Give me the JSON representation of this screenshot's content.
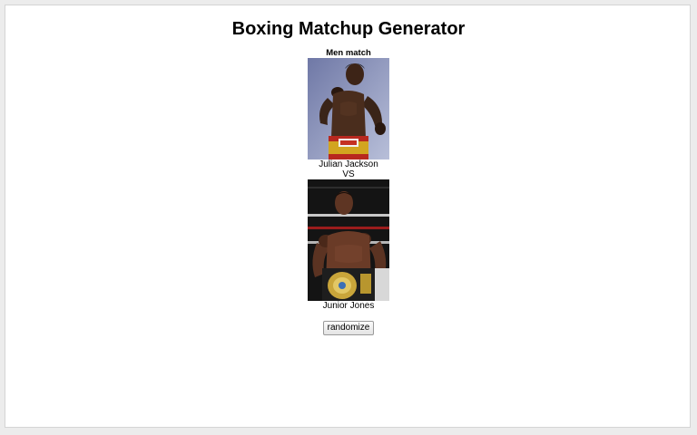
{
  "page": {
    "title": "Boxing Matchup Generator"
  },
  "match": {
    "section_label": "Men match",
    "fighter1": {
      "name": "Julian Jackson"
    },
    "vs_label": "VS",
    "fighter2": {
      "name": "Junior Jones"
    }
  },
  "controls": {
    "randomize_label": "randomize"
  }
}
